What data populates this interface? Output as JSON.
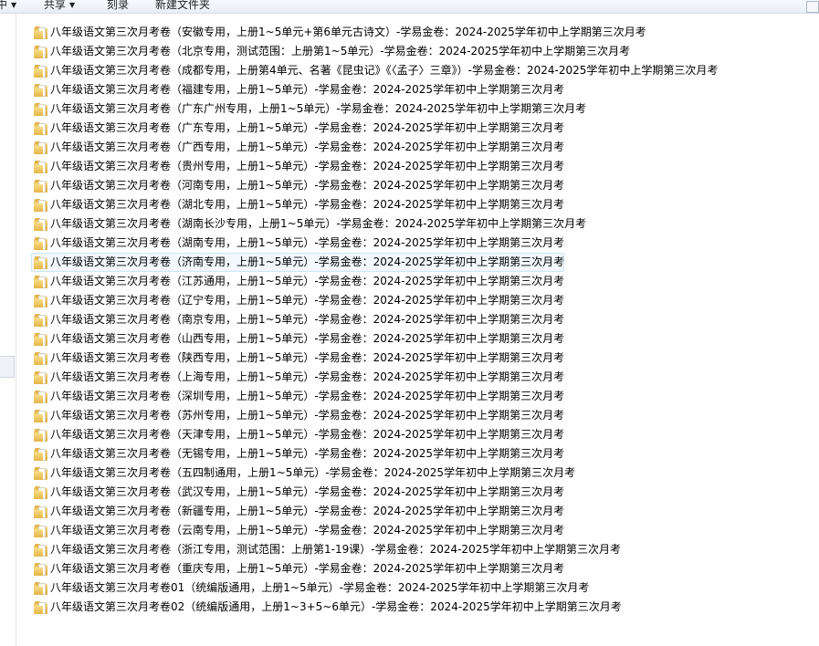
{
  "toolbar": {
    "partial_label": "中",
    "share_label": "共享",
    "burn_label": "刻录",
    "new_folder_label": "新建文件夹"
  },
  "folders": [
    {
      "name": "八年级语文第三次月考卷（安徽专用，上册1~5单元+第6单元古诗文）-学易金卷：2024-2025学年初中上学期第三次月考"
    },
    {
      "name": "八年级语文第三次月考卷（北京专用，测试范围：上册第1~5单元）-学易金卷：2024-2025学年初中上学期第三次月考"
    },
    {
      "name": "八年级语文第三次月考卷（成都专用，上册第4单元、名著《昆虫记》《〈孟子〉三章》）-学易金卷：2024-2025学年初中上学期第三次月考"
    },
    {
      "name": "八年级语文第三次月考卷（福建专用，上册1~5单元）-学易金卷：2024-2025学年初中上学期第三次月考"
    },
    {
      "name": "八年级语文第三次月考卷（广东广州专用，上册1~5单元）-学易金卷：2024-2025学年初中上学期第三次月考"
    },
    {
      "name": "八年级语文第三次月考卷（广东专用，上册1~5单元）-学易金卷：2024-2025学年初中上学期第三次月考"
    },
    {
      "name": "八年级语文第三次月考卷（广西专用，上册1~5单元）-学易金卷：2024-2025学年初中上学期第三次月考"
    },
    {
      "name": "八年级语文第三次月考卷（贵州专用，上册1~5单元）-学易金卷：2024-2025学年初中上学期第三次月考"
    },
    {
      "name": "八年级语文第三次月考卷（河南专用，上册1~5单元）-学易金卷：2024-2025学年初中上学期第三次月考"
    },
    {
      "name": "八年级语文第三次月考卷（湖北专用，上册1~5单元）-学易金卷：2024-2025学年初中上学期第三次月考"
    },
    {
      "name": "八年级语文第三次月考卷（湖南长沙专用，上册1~5单元）-学易金卷：2024-2025学年初中上学期第三次月考"
    },
    {
      "name": "八年级语文第三次月考卷（湖南专用，上册1~5单元）-学易金卷：2024-2025学年初中上学期第三次月考"
    },
    {
      "name": "八年级语文第三次月考卷（济南专用，上册1~5单元）-学易金卷：2024-2025学年初中上学期第三次月考"
    },
    {
      "name": "八年级语文第三次月考卷（江苏通用，上册1~5单元）-学易金卷：2024-2025学年初中上学期第三次月考"
    },
    {
      "name": "八年级语文第三次月考卷（辽宁专用，上册1~5单元）-学易金卷：2024-2025学年初中上学期第三次月考"
    },
    {
      "name": "八年级语文第三次月考卷（南京专用，上册1~5单元）-学易金卷：2024-2025学年初中上学期第三次月考"
    },
    {
      "name": "八年级语文第三次月考卷（山西专用，上册1~5单元）-学易金卷：2024-2025学年初中上学期第三次月考"
    },
    {
      "name": "八年级语文第三次月考卷（陕西专用，上册1~5单元）-学易金卷：2024-2025学年初中上学期第三次月考"
    },
    {
      "name": "八年级语文第三次月考卷（上海专用，上册1~5单元）-学易金卷：2024-2025学年初中上学期第三次月考"
    },
    {
      "name": "八年级语文第三次月考卷（深圳专用，上册1~5单元）-学易金卷：2024-2025学年初中上学期第三次月考"
    },
    {
      "name": "八年级语文第三次月考卷（苏州专用，上册1~5单元）-学易金卷：2024-2025学年初中上学期第三次月考"
    },
    {
      "name": "八年级语文第三次月考卷（天津专用，上册1~5单元）-学易金卷：2024-2025学年初中上学期第三次月考"
    },
    {
      "name": "八年级语文第三次月考卷（无锡专用，上册1~5单元）-学易金卷：2024-2025学年初中上学期第三次月考"
    },
    {
      "name": "八年级语文第三次月考卷（五四制通用，上册1~5单元）-学易金卷：2024-2025学年初中上学期第三次月考"
    },
    {
      "name": "八年级语文第三次月考卷（武汉专用，上册1~5单元）-学易金卷：2024-2025学年初中上学期第三次月考"
    },
    {
      "name": "八年级语文第三次月考卷（新疆专用，上册1~5单元）-学易金卷：2024-2025学年初中上学期第三次月考"
    },
    {
      "name": "八年级语文第三次月考卷（云南专用，上册1~5单元）-学易金卷：2024-2025学年初中上学期第三次月考"
    },
    {
      "name": "八年级语文第三次月考卷（浙江专用，测试范围：上册第1-19课）-学易金卷：2024-2025学年初中上学期第三次月考"
    },
    {
      "name": "八年级语文第三次月考卷（重庆专用，上册1~5单元）-学易金卷：2024-2025学年初中上学期第三次月考"
    },
    {
      "name": "八年级语文第三次月考卷01（统编版通用，上册1~5单元）-学易金卷：2024-2025学年初中上学期第三次月考"
    },
    {
      "name": "八年级语文第三次月考卷02（统编版通用，上册1~3+5~6单元）-学易金卷：2024-2025学年初中上学期第三次月考"
    }
  ],
  "selected_index": 12
}
